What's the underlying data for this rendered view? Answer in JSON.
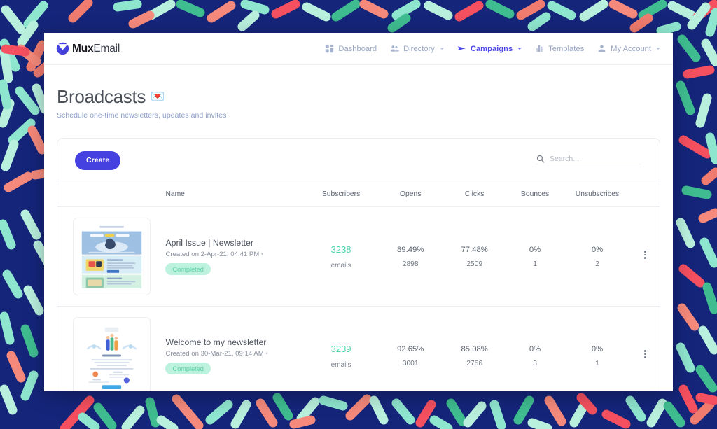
{
  "theme": {
    "bg_navy": "#15257a",
    "accent_indigo": "#4540e0",
    "accent_link": "#4e48e8",
    "mint": "#4fd6ac",
    "badge_bg": "#bdf2de",
    "confetti_colors": [
      "#b9f0dd",
      "#3fbd90",
      "#f58a7c",
      "#f43d55",
      "#8fe6cf",
      "#ef7c6e"
    ]
  },
  "brand": {
    "name_bold": "Mux",
    "name_light": "Email",
    "logo_icon": "mux-circle-check-icon"
  },
  "nav": {
    "items": [
      {
        "label": "Dashboard",
        "icon": "grid-icon",
        "active": false,
        "has_caret": false
      },
      {
        "label": "Directory",
        "icon": "people-icon",
        "active": false,
        "has_caret": true
      },
      {
        "label": "Campaigns",
        "icon": "paper-plane-icon",
        "active": true,
        "has_caret": true
      },
      {
        "label": "Templates",
        "icon": "layers-icon",
        "active": false,
        "has_caret": false
      },
      {
        "label": "My Account",
        "icon": "person-icon",
        "active": false,
        "has_caret": true
      }
    ]
  },
  "page": {
    "title": "Broadcasts",
    "title_emoji": "💌",
    "subtitle": "Schedule one-time newsletters, updates and invites"
  },
  "toolbar": {
    "create_label": "Create",
    "search_placeholder": "Search...",
    "search_value": "",
    "search_icon": "search-icon"
  },
  "table": {
    "columns": [
      "",
      "Name",
      "Subscribers",
      "Opens",
      "Clicks",
      "Bounces",
      "Unsubscribes",
      ""
    ],
    "rows": [
      {
        "thumbnail": "april-issue-newsletter-thumbnail",
        "name": "April Issue | Newsletter",
        "created": "Created on 2-Apr-21, 04:41 PM",
        "status": "Completed",
        "subscribers": "3238",
        "subscribers_unit": "emails",
        "opens_pct": "89.49%",
        "opens_count": "2898",
        "clicks_pct": "77.48%",
        "clicks_count": "2509",
        "bounces_pct": "0%",
        "bounces_count": "1",
        "unsubscribes_pct": "0%",
        "unsubscribes_count": "2",
        "menu_icon": "kebab-menu-icon"
      },
      {
        "thumbnail": "welcome-newsletter-thumbnail",
        "name": "Welcome to my newsletter",
        "created": "Created on 30-Mar-21, 09:14 AM",
        "status": "Completed",
        "subscribers": "3239",
        "subscribers_unit": "emails",
        "opens_pct": "92.65%",
        "opens_count": "3001",
        "clicks_pct": "85.08%",
        "clicks_count": "2756",
        "bounces_pct": "0%",
        "bounces_count": "3",
        "unsubscribes_pct": "0%",
        "unsubscribes_count": "1",
        "menu_icon": "kebab-menu-icon"
      }
    ]
  }
}
